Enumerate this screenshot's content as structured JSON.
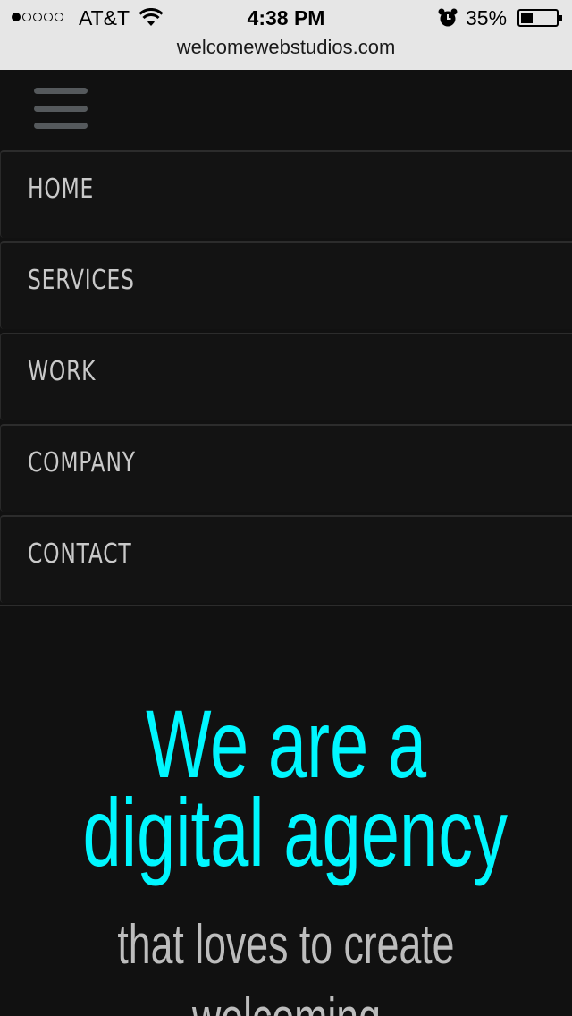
{
  "status_bar": {
    "signal_dots": [
      true,
      false,
      false,
      false,
      false
    ],
    "carrier": "AT&T",
    "time": "4:38 PM",
    "battery_percent": "35%",
    "battery_level": 0.35,
    "icons": [
      "wifi-icon",
      "alarm-icon",
      "battery-icon"
    ]
  },
  "browser": {
    "url": "welcomewebstudios.com"
  },
  "header": {
    "menu_icon": "hamburger-menu-icon",
    "menu_color": "#55595c"
  },
  "nav": {
    "items": [
      {
        "label": "HOME"
      },
      {
        "label": "SERVICES"
      },
      {
        "label": "WORK"
      },
      {
        "label": "COMPANY"
      },
      {
        "label": "CONTACT"
      }
    ]
  },
  "hero": {
    "headline_line1": "We are a",
    "headline_line2": "digital agency",
    "sub_line1": "that loves to create",
    "sub_line2": "welcoming",
    "headline_color": "#00f7ff",
    "sub_color": "#bdbdbd",
    "background": "#111111"
  }
}
